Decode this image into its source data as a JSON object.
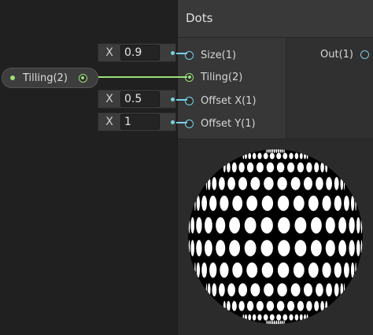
{
  "node": {
    "title": "Dots",
    "inputs": [
      {
        "label": "Size(1)"
      },
      {
        "label": "Tiling(2)"
      },
      {
        "label": "Offset X(1)"
      },
      {
        "label": "Offset Y(1)"
      }
    ],
    "outputs": [
      {
        "label": "Out(1)"
      }
    ]
  },
  "fields": [
    {
      "axis": "X",
      "value": "0.9"
    },
    {
      "axis": "X",
      "value": "0.5"
    },
    {
      "axis": "X",
      "value": "1"
    }
  ],
  "property": {
    "label": "Tilling(2)"
  },
  "colors": {
    "background": "#202020",
    "node_body": "#303030",
    "float_port": "#7ad0e6",
    "vector2_port": "#9be07a"
  }
}
